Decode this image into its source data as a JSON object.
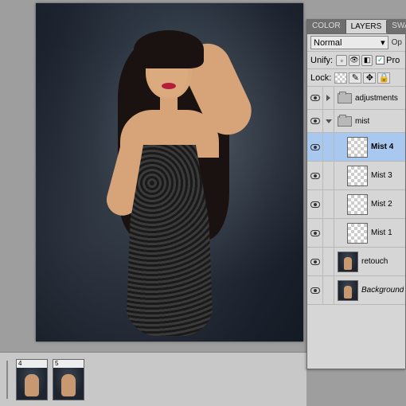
{
  "tabs": {
    "color": "COLOR",
    "layers": "LAYERS",
    "swatches": "SWATCH"
  },
  "blend_mode": "Normal",
  "opacity_label": "Op",
  "unify_label": "Unify:",
  "propagate_label": "Pro",
  "lock_label": "Lock:",
  "layers": {
    "adjustments": "adjustments",
    "mist_group": "mist",
    "mist4": "Mist 4",
    "mist3": "Mist 3",
    "mist2": "Mist 2",
    "mist1": "Mist 1",
    "retouch": "retouch",
    "background": "Background"
  },
  "thumbs": {
    "t4": "4",
    "t5": "5"
  }
}
